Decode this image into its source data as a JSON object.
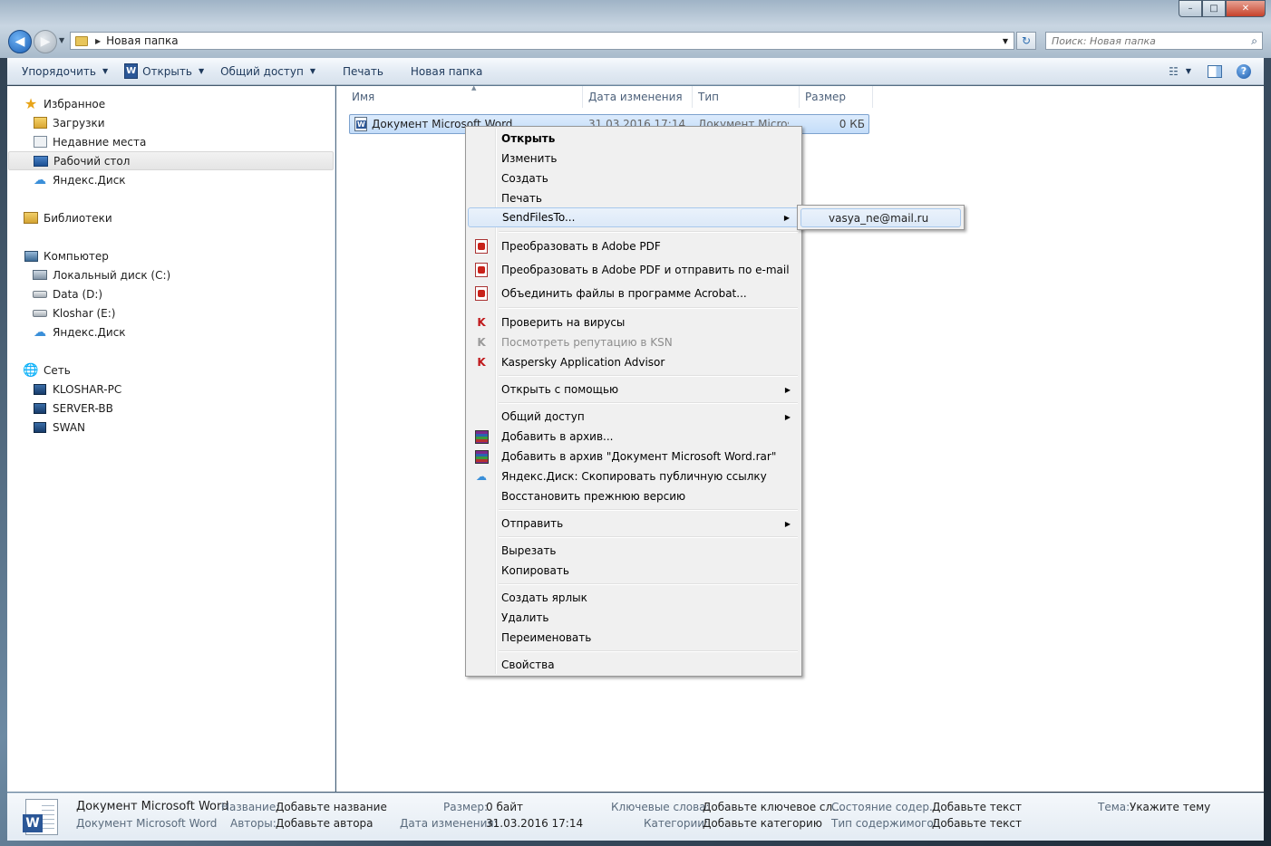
{
  "window": {
    "minimize": "–",
    "maximize": "□",
    "close": "✕"
  },
  "address": {
    "path": "Новая папка",
    "search_placeholder": "Поиск: Новая папка"
  },
  "toolbar": {
    "organize": "Упорядочить",
    "open": "Открыть",
    "share": "Общий доступ",
    "print": "Печать",
    "new_folder": "Новая папка"
  },
  "sidebar": {
    "favorites": "Избранное",
    "downloads": "Загрузки",
    "recent": "Недавние места",
    "desktop": "Рабочий стол",
    "yandex_disk": "Яндекс.Диск",
    "libraries": "Библиотеки",
    "computer": "Компьютер",
    "drive_c": "Локальный диск (C:)",
    "drive_d": "Data (D:)",
    "drive_e": "Kloshar (E:)",
    "yandex_disk2": "Яндекс.Диск",
    "network": "Сеть",
    "host1": "KLOSHAR-PC",
    "host2": "SERVER-BB",
    "host3": "SWAN"
  },
  "columns": {
    "name": "Имя",
    "date": "Дата изменения",
    "type": "Тип",
    "size": "Размер"
  },
  "file": {
    "name": "Документ Microsoft Word",
    "date": "31.03.2016 17:14",
    "type": "Документ Micros...",
    "size": "0 КБ"
  },
  "context_menu": {
    "open": "Открыть",
    "edit": "Изменить",
    "create": "Создать",
    "print": "Печать",
    "sendfilesto": "SendFilesTo...",
    "to_pdf": "Преобразовать в Adobe PDF",
    "to_pdf_email": "Преобразовать в Adobe PDF и отправить по e-mail",
    "combine_acrobat": "Объединить файлы в программе Acrobat...",
    "scan_virus": "Проверить на вирусы",
    "ksn_reputation": "Посмотреть репутацию в KSN",
    "kaspersky_advisor": "Kaspersky Application Advisor",
    "open_with": "Открыть с помощью",
    "share": "Общий доступ",
    "add_archive": "Добавить в архив...",
    "add_archive_named": "Добавить в архив \"Документ Microsoft Word.rar\"",
    "yandex_copy_link": "Яндекс.Диск: Скопировать публичную ссылку",
    "restore_prev": "Восстановить прежнюю версию",
    "send_to": "Отправить",
    "cut": "Вырезать",
    "copy": "Копировать",
    "create_shortcut": "Создать ярлык",
    "delete": "Удалить",
    "rename": "Переименовать",
    "properties": "Свойства"
  },
  "submenu": {
    "email": "vasya_ne@mail.ru"
  },
  "details": {
    "file_name": "Документ Microsoft Word",
    "file_type": "Документ Microsoft Word",
    "title_key": "Название:",
    "title_val": "Добавьте название",
    "authors_key": "Авторы:",
    "authors_val": "Добавьте автора",
    "size_key": "Размер:",
    "size_val": "0 байт",
    "modified_key": "Дата изменения:",
    "modified_val": "31.03.2016 17:14",
    "keywords_key": "Ключевые слова:",
    "keywords_val": "Добавьте ключевое сл...",
    "categories_key": "Категории:",
    "categories_val": "Добавьте категорию",
    "content_status_key": "Состояние содер...",
    "content_status_val": "Добавьте текст",
    "content_type_key": "Тип содержимого:",
    "content_type_val": "Добавьте текст",
    "subject_key": "Тема:",
    "subject_val": "Укажите тему"
  }
}
